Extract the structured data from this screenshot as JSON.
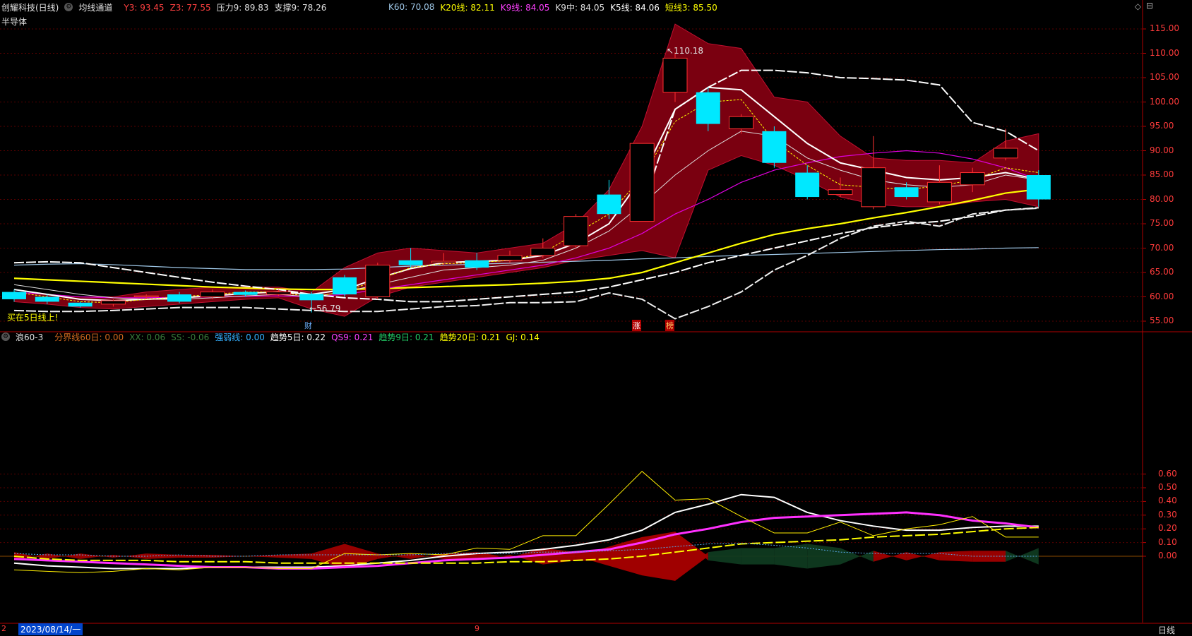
{
  "stock": {
    "name": "创耀科技(日线)",
    "sector": "半导体"
  },
  "indicator_main": {
    "name": "均线通道",
    "items": [
      {
        "label": "Y3: 93.45",
        "color": "#ff4040"
      },
      {
        "label": "Z3: 77.55",
        "color": "#ff4040"
      },
      {
        "label": "压力9: 89.83",
        "color": "#e0e0e0"
      },
      {
        "label": "支撑9: 78.26",
        "color": "#e0e0e0"
      }
    ],
    "items_right": [
      {
        "label": "K60: 70.08",
        "color": "#9fc8e8"
      },
      {
        "label": "K20线: 82.11",
        "color": "#ffff00"
      },
      {
        "label": "K9线: 84.05",
        "color": "#ff40ff"
      },
      {
        "label": "K9中: 84.05",
        "color": "#e0e0e0"
      },
      {
        "label": "K5线: 84.06",
        "color": "#ffffff"
      },
      {
        "label": "短线3: 85.50",
        "color": "#ffff00"
      }
    ]
  },
  "indicator_sub": {
    "name": "浪60-3",
    "items": [
      {
        "label": "分界线60日: 0.00",
        "color": "#d2691e"
      },
      {
        "label": "XX: 0.06",
        "color": "#3a7d3a"
      },
      {
        "label": "SS: -0.06",
        "color": "#3a7d3a"
      },
      {
        "label": "强弱线: 0.00",
        "color": "#35b0ff"
      },
      {
        "label": "趋势5日: 0.22",
        "color": "#ffffff"
      },
      {
        "label": "QS9: 0.21",
        "color": "#ff40ff"
      },
      {
        "label": "趋势9日: 0.21",
        "color": "#22cc66"
      },
      {
        "label": "趋势20日: 0.21",
        "color": "#ffff00"
      },
      {
        "label": "GJ: 0.14",
        "color": "#ffff00"
      }
    ]
  },
  "annotations": {
    "high_label": "110.18",
    "low_label": "56.79",
    "signal_text": "买在5日线上!",
    "marker_cai": "财",
    "marker_zhang": "涨",
    "marker_bang": "榜"
  },
  "bottom": {
    "date": "2023/08/14/一",
    "period": "日线",
    "mark_left": "2",
    "mark_mid": "9"
  },
  "price_axis": [
    "115.00",
    "110.00",
    "105.00",
    "100.00",
    "95.00",
    "90.00",
    "85.00",
    "80.00",
    "75.00",
    "70.00",
    "65.00",
    "60.00",
    "55.00"
  ],
  "osc_axis": [
    "0.60",
    "0.50",
    "0.40",
    "0.30",
    "0.20",
    "0.10",
    "0.00"
  ],
  "chart_data": {
    "type": "candlestick",
    "candles": [
      {
        "o": 61.0,
        "c": 59.5,
        "h": 61.5,
        "l": 59.0
      },
      {
        "o": 60.0,
        "c": 59.0,
        "h": 60.5,
        "l": 58.5
      },
      {
        "o": 58.8,
        "c": 58.0,
        "h": 59.0,
        "l": 57.8
      },
      {
        "o": 58.5,
        "c": 59.2,
        "h": 59.5,
        "l": 58.0
      },
      {
        "o": 60.0,
        "c": 60.2,
        "h": 60.5,
        "l": 59.5
      },
      {
        "o": 60.5,
        "c": 59.0,
        "h": 61.0,
        "l": 58.7
      },
      {
        "o": 60.0,
        "c": 61.0,
        "h": 61.5,
        "l": 59.5
      },
      {
        "o": 61.0,
        "c": 60.4,
        "h": 61.3,
        "l": 60.0
      },
      {
        "o": 60.5,
        "c": 61.0,
        "h": 61.5,
        "l": 60.2
      },
      {
        "o": 60.6,
        "c": 59.3,
        "h": 61.0,
        "l": 56.79
      },
      {
        "o": 64.0,
        "c": 60.5,
        "h": 64.5,
        "l": 60.0
      },
      {
        "o": 60.0,
        "c": 66.5,
        "h": 67.0,
        "l": 59.5
      },
      {
        "o": 67.5,
        "c": 66.5,
        "h": 70.0,
        "l": 66.0
      },
      {
        "o": 67.0,
        "c": 67.3,
        "h": 69.0,
        "l": 66.5
      },
      {
        "o": 67.5,
        "c": 66.0,
        "h": 69.0,
        "l": 65.5
      },
      {
        "o": 67.5,
        "c": 68.5,
        "h": 69.5,
        "l": 67.0
      },
      {
        "o": 68.5,
        "c": 70.0,
        "h": 72.0,
        "l": 68.0
      },
      {
        "o": 70.5,
        "c": 76.5,
        "h": 77.0,
        "l": 70.0
      },
      {
        "o": 81.0,
        "c": 77.0,
        "h": 84.0,
        "l": 76.0
      },
      {
        "o": 75.5,
        "c": 91.5,
        "h": 91.5,
        "l": 75.5
      },
      {
        "o": 102.0,
        "c": 109.0,
        "h": 110.18,
        "l": 100.0
      },
      {
        "o": 102.0,
        "c": 95.5,
        "h": 103.0,
        "l": 94.0
      },
      {
        "o": 94.5,
        "c": 97.0,
        "h": 97.5,
        "l": 93.5
      },
      {
        "o": 94.0,
        "c": 87.5,
        "h": 95.0,
        "l": 86.5
      },
      {
        "o": 85.5,
        "c": 80.5,
        "h": 87.0,
        "l": 80.0
      },
      {
        "o": 81.0,
        "c": 82.0,
        "h": 84.5,
        "l": 80.5
      },
      {
        "o": 78.5,
        "c": 86.5,
        "h": 93.0,
        "l": 78.0
      },
      {
        "o": 82.5,
        "c": 80.5,
        "h": 83.5,
        "l": 80.0
      },
      {
        "o": 79.5,
        "c": 83.5,
        "h": 87.0,
        "l": 79.0
      },
      {
        "o": 83.0,
        "c": 85.5,
        "h": 86.5,
        "l": 81.5
      },
      {
        "o": 88.5,
        "c": 90.5,
        "h": 94.5,
        "l": 88.0
      },
      {
        "o": 85.0,
        "c": 80.0,
        "h": 86.0,
        "l": 78.5
      }
    ]
  }
}
